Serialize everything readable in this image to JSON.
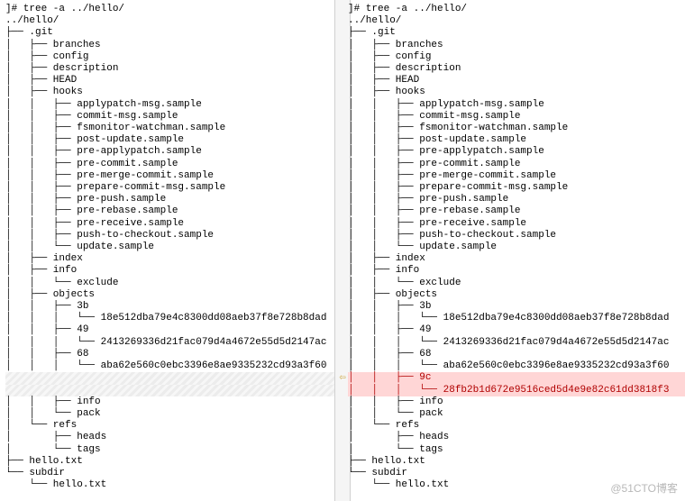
{
  "command": "]# tree -a ../hello/",
  "root": "../hello/",
  "watermark": "@51CTO博客",
  "tree_chars": {
    "pipe": "│   ",
    "tee": "├── ",
    "ell": "└── ",
    "blank": "    "
  },
  "left_lines": [
    {
      "depth_prefix": "",
      "branch": "",
      "text": "]# tree -a ../hello/"
    },
    {
      "depth_prefix": "",
      "branch": "",
      "text": "../hello/"
    },
    {
      "depth_prefix": "",
      "branch": "├── ",
      "text": ".git"
    },
    {
      "depth_prefix": "│   ",
      "branch": "├── ",
      "text": "branches"
    },
    {
      "depth_prefix": "│   ",
      "branch": "├── ",
      "text": "config"
    },
    {
      "depth_prefix": "│   ",
      "branch": "├── ",
      "text": "description"
    },
    {
      "depth_prefix": "│   ",
      "branch": "├── ",
      "text": "HEAD"
    },
    {
      "depth_prefix": "│   ",
      "branch": "├── ",
      "text": "hooks"
    },
    {
      "depth_prefix": "│   │   ",
      "branch": "├── ",
      "text": "applypatch-msg.sample"
    },
    {
      "depth_prefix": "│   │   ",
      "branch": "├── ",
      "text": "commit-msg.sample"
    },
    {
      "depth_prefix": "│   │   ",
      "branch": "├── ",
      "text": "fsmonitor-watchman.sample"
    },
    {
      "depth_prefix": "│   │   ",
      "branch": "├── ",
      "text": "post-update.sample"
    },
    {
      "depth_prefix": "│   │   ",
      "branch": "├── ",
      "text": "pre-applypatch.sample"
    },
    {
      "depth_prefix": "│   │   ",
      "branch": "├── ",
      "text": "pre-commit.sample"
    },
    {
      "depth_prefix": "│   │   ",
      "branch": "├── ",
      "text": "pre-merge-commit.sample"
    },
    {
      "depth_prefix": "│   │   ",
      "branch": "├── ",
      "text": "prepare-commit-msg.sample"
    },
    {
      "depth_prefix": "│   │   ",
      "branch": "├── ",
      "text": "pre-push.sample"
    },
    {
      "depth_prefix": "│   │   ",
      "branch": "├── ",
      "text": "pre-rebase.sample"
    },
    {
      "depth_prefix": "│   │   ",
      "branch": "├── ",
      "text": "pre-receive.sample"
    },
    {
      "depth_prefix": "│   │   ",
      "branch": "├── ",
      "text": "push-to-checkout.sample"
    },
    {
      "depth_prefix": "│   │   ",
      "branch": "└── ",
      "text": "update.sample"
    },
    {
      "depth_prefix": "│   ",
      "branch": "├── ",
      "text": "index"
    },
    {
      "depth_prefix": "│   ",
      "branch": "├── ",
      "text": "info"
    },
    {
      "depth_prefix": "│   │   ",
      "branch": "└── ",
      "text": "exclude"
    },
    {
      "depth_prefix": "│   ",
      "branch": "├── ",
      "text": "objects"
    },
    {
      "depth_prefix": "│   │   ",
      "branch": "├── ",
      "text": "3b"
    },
    {
      "depth_prefix": "│   │   │   ",
      "branch": "└── ",
      "text": "18e512dba79e4c8300dd08aeb37f8e728b8dad"
    },
    {
      "depth_prefix": "│   │   ",
      "branch": "├── ",
      "text": "49"
    },
    {
      "depth_prefix": "│   │   │   ",
      "branch": "└── ",
      "text": "2413269336d21fac079d4a4672e55d5d2147ac"
    },
    {
      "depth_prefix": "│   │   ",
      "branch": "├── ",
      "text": "68"
    },
    {
      "depth_prefix": "│   │   │   ",
      "branch": "└── ",
      "text": "aba62e560c0ebc3396e8ae9335232cd93a3f60"
    },
    {
      "hatch": true,
      "depth_prefix": "",
      "branch": "",
      "text": ""
    },
    {
      "hatch": true,
      "depth_prefix": "",
      "branch": "",
      "text": ""
    },
    {
      "depth_prefix": "│   │   ",
      "branch": "├── ",
      "text": "info"
    },
    {
      "depth_prefix": "│   │   ",
      "branch": "└── ",
      "text": "pack"
    },
    {
      "depth_prefix": "│   ",
      "branch": "└── ",
      "text": "refs"
    },
    {
      "depth_prefix": "│       ",
      "branch": "├── ",
      "text": "heads"
    },
    {
      "depth_prefix": "│       ",
      "branch": "└── ",
      "text": "tags"
    },
    {
      "depth_prefix": "",
      "branch": "├── ",
      "text": "hello.txt"
    },
    {
      "depth_prefix": "",
      "branch": "└── ",
      "text": "subdir"
    },
    {
      "depth_prefix": "    ",
      "branch": "└── ",
      "text": "hello.txt"
    }
  ],
  "right_lines": [
    {
      "depth_prefix": "",
      "branch": "",
      "text": "]# tree -a ../hello/"
    },
    {
      "depth_prefix": "",
      "branch": "",
      "text": "../hello/"
    },
    {
      "depth_prefix": "",
      "branch": "├── ",
      "text": ".git"
    },
    {
      "depth_prefix": "│   ",
      "branch": "├── ",
      "text": "branches"
    },
    {
      "depth_prefix": "│   ",
      "branch": "├── ",
      "text": "config"
    },
    {
      "depth_prefix": "│   ",
      "branch": "├── ",
      "text": "description"
    },
    {
      "depth_prefix": "│   ",
      "branch": "├── ",
      "text": "HEAD"
    },
    {
      "depth_prefix": "│   ",
      "branch": "├── ",
      "text": "hooks"
    },
    {
      "depth_prefix": "│   │   ",
      "branch": "├── ",
      "text": "applypatch-msg.sample"
    },
    {
      "depth_prefix": "│   │   ",
      "branch": "├── ",
      "text": "commit-msg.sample"
    },
    {
      "depth_prefix": "│   │   ",
      "branch": "├── ",
      "text": "fsmonitor-watchman.sample"
    },
    {
      "depth_prefix": "│   │   ",
      "branch": "├── ",
      "text": "post-update.sample"
    },
    {
      "depth_prefix": "│   │   ",
      "branch": "├── ",
      "text": "pre-applypatch.sample"
    },
    {
      "depth_prefix": "│   │   ",
      "branch": "├── ",
      "text": "pre-commit.sample"
    },
    {
      "depth_prefix": "│   │   ",
      "branch": "├── ",
      "text": "pre-merge-commit.sample"
    },
    {
      "depth_prefix": "│   │   ",
      "branch": "├── ",
      "text": "prepare-commit-msg.sample"
    },
    {
      "depth_prefix": "│   │   ",
      "branch": "├── ",
      "text": "pre-push.sample"
    },
    {
      "depth_prefix": "│   │   ",
      "branch": "├── ",
      "text": "pre-rebase.sample"
    },
    {
      "depth_prefix": "│   │   ",
      "branch": "├── ",
      "text": "pre-receive.sample"
    },
    {
      "depth_prefix": "│   │   ",
      "branch": "├── ",
      "text": "push-to-checkout.sample"
    },
    {
      "depth_prefix": "│   │   ",
      "branch": "└── ",
      "text": "update.sample"
    },
    {
      "depth_prefix": "│   ",
      "branch": "├── ",
      "text": "index"
    },
    {
      "depth_prefix": "│   ",
      "branch": "├── ",
      "text": "info"
    },
    {
      "depth_prefix": "│   │   ",
      "branch": "└── ",
      "text": "exclude"
    },
    {
      "depth_prefix": "│   ",
      "branch": "├── ",
      "text": "objects"
    },
    {
      "depth_prefix": "│   │   ",
      "branch": "├── ",
      "text": "3b"
    },
    {
      "depth_prefix": "│   │   │   ",
      "branch": "└── ",
      "text": "18e512dba79e4c8300dd08aeb37f8e728b8dad"
    },
    {
      "depth_prefix": "│   │   ",
      "branch": "├── ",
      "text": "49"
    },
    {
      "depth_prefix": "│   │   │   ",
      "branch": "└── ",
      "text": "2413269336d21fac079d4a4672e55d5d2147ac"
    },
    {
      "depth_prefix": "│   │   ",
      "branch": "├── ",
      "text": "68"
    },
    {
      "depth_prefix": "│   │   │   ",
      "branch": "└── ",
      "text": "aba62e560c0ebc3396e8ae9335232cd93a3f60"
    },
    {
      "added": true,
      "depth_prefix": "│   │   ",
      "branch": "├── ",
      "text": "9c"
    },
    {
      "added": true,
      "depth_prefix": "│   │   │   ",
      "branch": "└── ",
      "text": "28fb2b1d672e9516ced5d4e9e82c61dd3818f3"
    },
    {
      "depth_prefix": "│   │   ",
      "branch": "├── ",
      "text": "info"
    },
    {
      "depth_prefix": "│   │   ",
      "branch": "└── ",
      "text": "pack"
    },
    {
      "depth_prefix": "│   ",
      "branch": "└── ",
      "text": "refs"
    },
    {
      "depth_prefix": "│       ",
      "branch": "├── ",
      "text": "heads"
    },
    {
      "depth_prefix": "│       ",
      "branch": "└── ",
      "text": "tags"
    },
    {
      "depth_prefix": "",
      "branch": "├── ",
      "text": "hello.txt"
    },
    {
      "depth_prefix": "",
      "branch": "└── ",
      "text": "subdir"
    },
    {
      "depth_prefix": "    ",
      "branch": "└── ",
      "text": "hello.txt"
    }
  ],
  "diff_marker": {
    "line_index": 31,
    "glyph": "⇦"
  }
}
